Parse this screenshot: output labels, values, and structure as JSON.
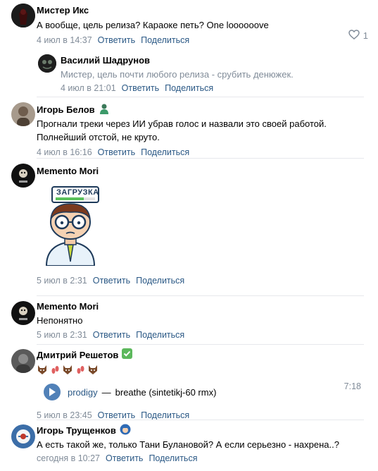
{
  "comments": [
    {
      "author": "Мистер Икс",
      "text": "А вообще, цель релиза? Караоке петь? One loooooove",
      "date": "4 июл в 14:37",
      "reply_label": "Ответить",
      "share_label": "Поделиться",
      "likes": "1",
      "avatar_color": "#1a1a1a"
    },
    {
      "author": "Василий Шадрунов",
      "text": "Мистер, цель почти любого релиза - срубить денюжек.",
      "date": "4 июл в 21:01",
      "reply_label": "Ответить",
      "share_label": "Поделиться",
      "avatar_color": "#2b2b2b"
    },
    {
      "author": "Игорь Белов",
      "text_line1": "Прогнали треки через ИИ убрав голос и назвали это своей работой.",
      "text_line2": "Полнейший отстой, не круто.",
      "date": "4 июл в 16:16",
      "reply_label": "Ответить",
      "share_label": "Поделиться",
      "avatar_color": "#8a7d70"
    },
    {
      "author": "Memento Mori",
      "date": "5 июл в 2:31",
      "reply_label": "Ответить",
      "share_label": "Поделиться",
      "sticker_label": "ЗАГРУЗКА",
      "avatar_color": "#111111"
    },
    {
      "author": "Memento Mori",
      "text": "Непонятно",
      "date": "5 июл в 2:31",
      "reply_label": "Ответить",
      "share_label": "Поделиться",
      "avatar_color": "#111111"
    },
    {
      "author": "Дмитрий Решетов",
      "audio_artist": "prodigy",
      "audio_title": "breathe (sintetikj-60 rmx)",
      "audio_duration": "7:18",
      "date": "5 июл в 23:45",
      "reply_label": "Ответить",
      "share_label": "Поделиться",
      "avatar_color": "#555555"
    },
    {
      "author": "Игорь Трущенков",
      "text": "А есть такой же, только Тани Булановой? А если серьезно - нахрена..?",
      "date": "сегодня в 10:27",
      "reply_label": "Ответить",
      "share_label": "Поделиться",
      "avatar_color": "#3c6ea8"
    }
  ],
  "colors": {
    "link": "#2a5885",
    "meta": "#818c99",
    "divider": "#e7e8ec",
    "play": "#5181b8"
  }
}
